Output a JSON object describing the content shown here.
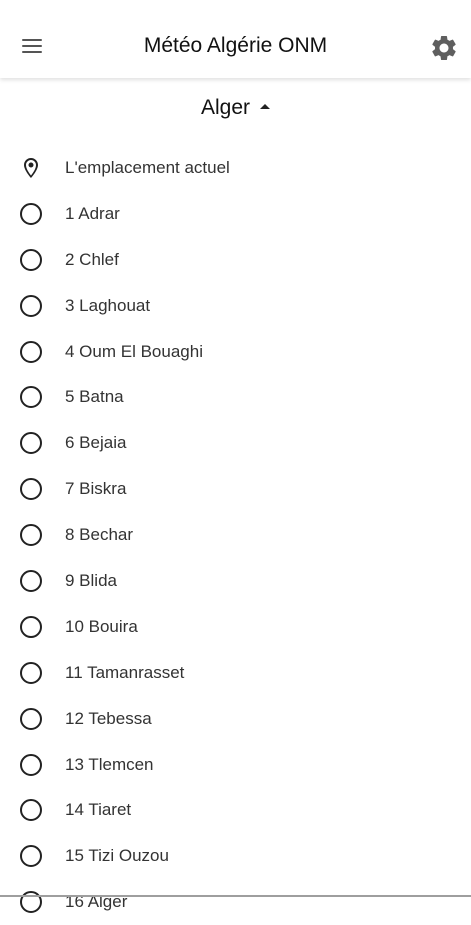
{
  "app": {
    "title": "Météo Algérie ONM"
  },
  "icons": {
    "menu": "hamburger-menu-icon",
    "settings": "gear-icon",
    "location": "location-pin-icon",
    "radio": "radio-unchecked-icon",
    "caret": "caret-up-icon"
  },
  "selector": {
    "label": "Alger"
  },
  "current_location": {
    "label": "L'emplacement actuel"
  },
  "cities": [
    "1 Adrar",
    "2 Chlef",
    "3 Laghouat",
    "4 Oum El Bouaghi",
    "5 Batna",
    "6 Bejaia",
    "7 Biskra",
    "8 Bechar",
    "9 Blida",
    "10 Bouira",
    "11 Tamanrasset",
    "12 Tebessa",
    "13 Tlemcen",
    "14 Tiaret",
    "15 Tizi Ouzou",
    "16 Alger"
  ]
}
